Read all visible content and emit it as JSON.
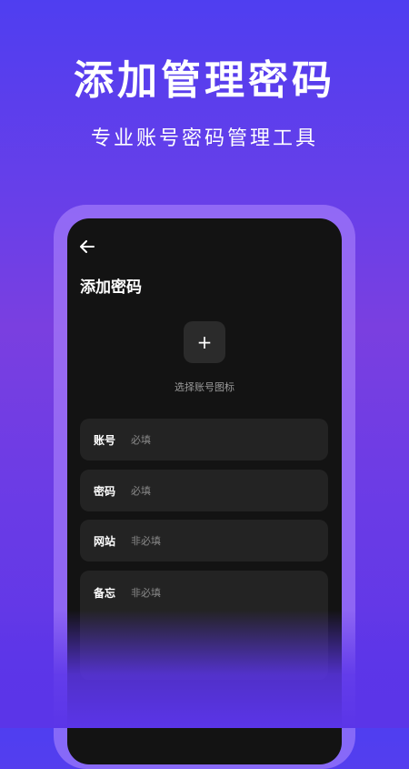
{
  "hero": {
    "title": "添加管理密码",
    "subtitle": "专业账号密码管理工具"
  },
  "screen": {
    "back_icon": "arrow-left-icon",
    "page_title": "添加密码",
    "icon_picker": {
      "symbol": "+",
      "label": "选择账号图标"
    },
    "fields": [
      {
        "label": "账号",
        "placeholder": "必填"
      },
      {
        "label": "密码",
        "placeholder": "必填"
      },
      {
        "label": "网站",
        "placeholder": "非必填"
      },
      {
        "label": "备忘",
        "placeholder": "非必填"
      }
    ]
  },
  "colors": {
    "background_top": "#4f3ef0",
    "background_bottom": "#5b35e8",
    "screen": "#131313",
    "field": "#232323"
  }
}
